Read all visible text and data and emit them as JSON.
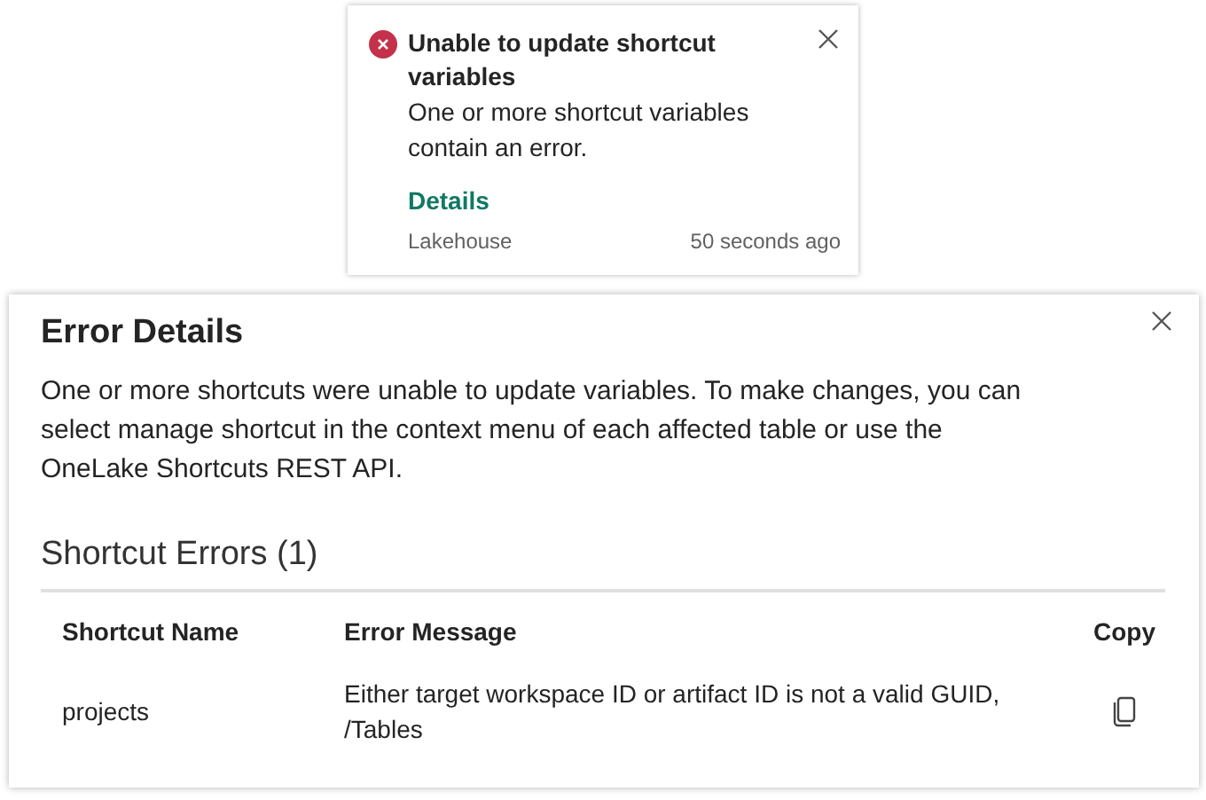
{
  "toast": {
    "kind": "error",
    "title": "Unable to update shortcut variables",
    "message": "One or more shortcut variables contain an error.",
    "link": "Details",
    "source": "Lakehouse",
    "time": "50 seconds ago"
  },
  "dialog": {
    "title": "Error Details",
    "description": "One or more shortcuts were unable to update variables. To make changes, you can select manage shortcut in the context menu of each affected table or use the OneLake Shortcuts REST API.",
    "section_title": "Shortcut Errors (1)",
    "table": {
      "columns": [
        "Shortcut Name",
        "Error Message",
        "Copy"
      ],
      "rows": [
        {
          "name": "projects",
          "error": "Either target workspace ID or artifact ID is not a valid GUID, /Tables"
        }
      ]
    }
  }
}
